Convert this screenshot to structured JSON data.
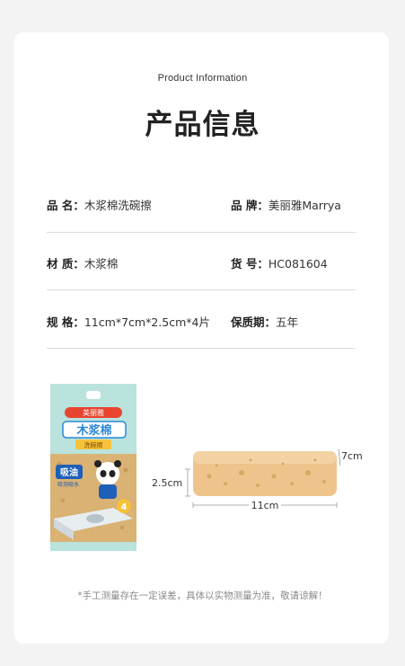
{
  "header": {
    "subtitle": "Product Information",
    "title": "产品信息"
  },
  "specs": [
    {
      "label": "品  名：",
      "value": "木浆棉洗碗擦",
      "label2": "品  牌：",
      "value2": "美丽雅Marrya"
    },
    {
      "label": "材  质：",
      "value": "木浆棉",
      "label2": "货  号：",
      "value2": "HC081604"
    },
    {
      "label": "规  格：",
      "value": "11cm*7cm*2.5cm*4片",
      "label2": "保质期：",
      "value2": "五年"
    }
  ],
  "package": {
    "brand": "美丽雅",
    "name": "木浆棉",
    "tag": "洗碗擦",
    "badge": "吸油",
    "badge_sub": "吸泡吸水",
    "count": "4"
  },
  "dimensions": {
    "height": "2.5cm",
    "depth": "7cm",
    "length": "11cm"
  },
  "footnote": "*手工测量存在一定误差，具体以实物测量为准，敬请谅解！"
}
